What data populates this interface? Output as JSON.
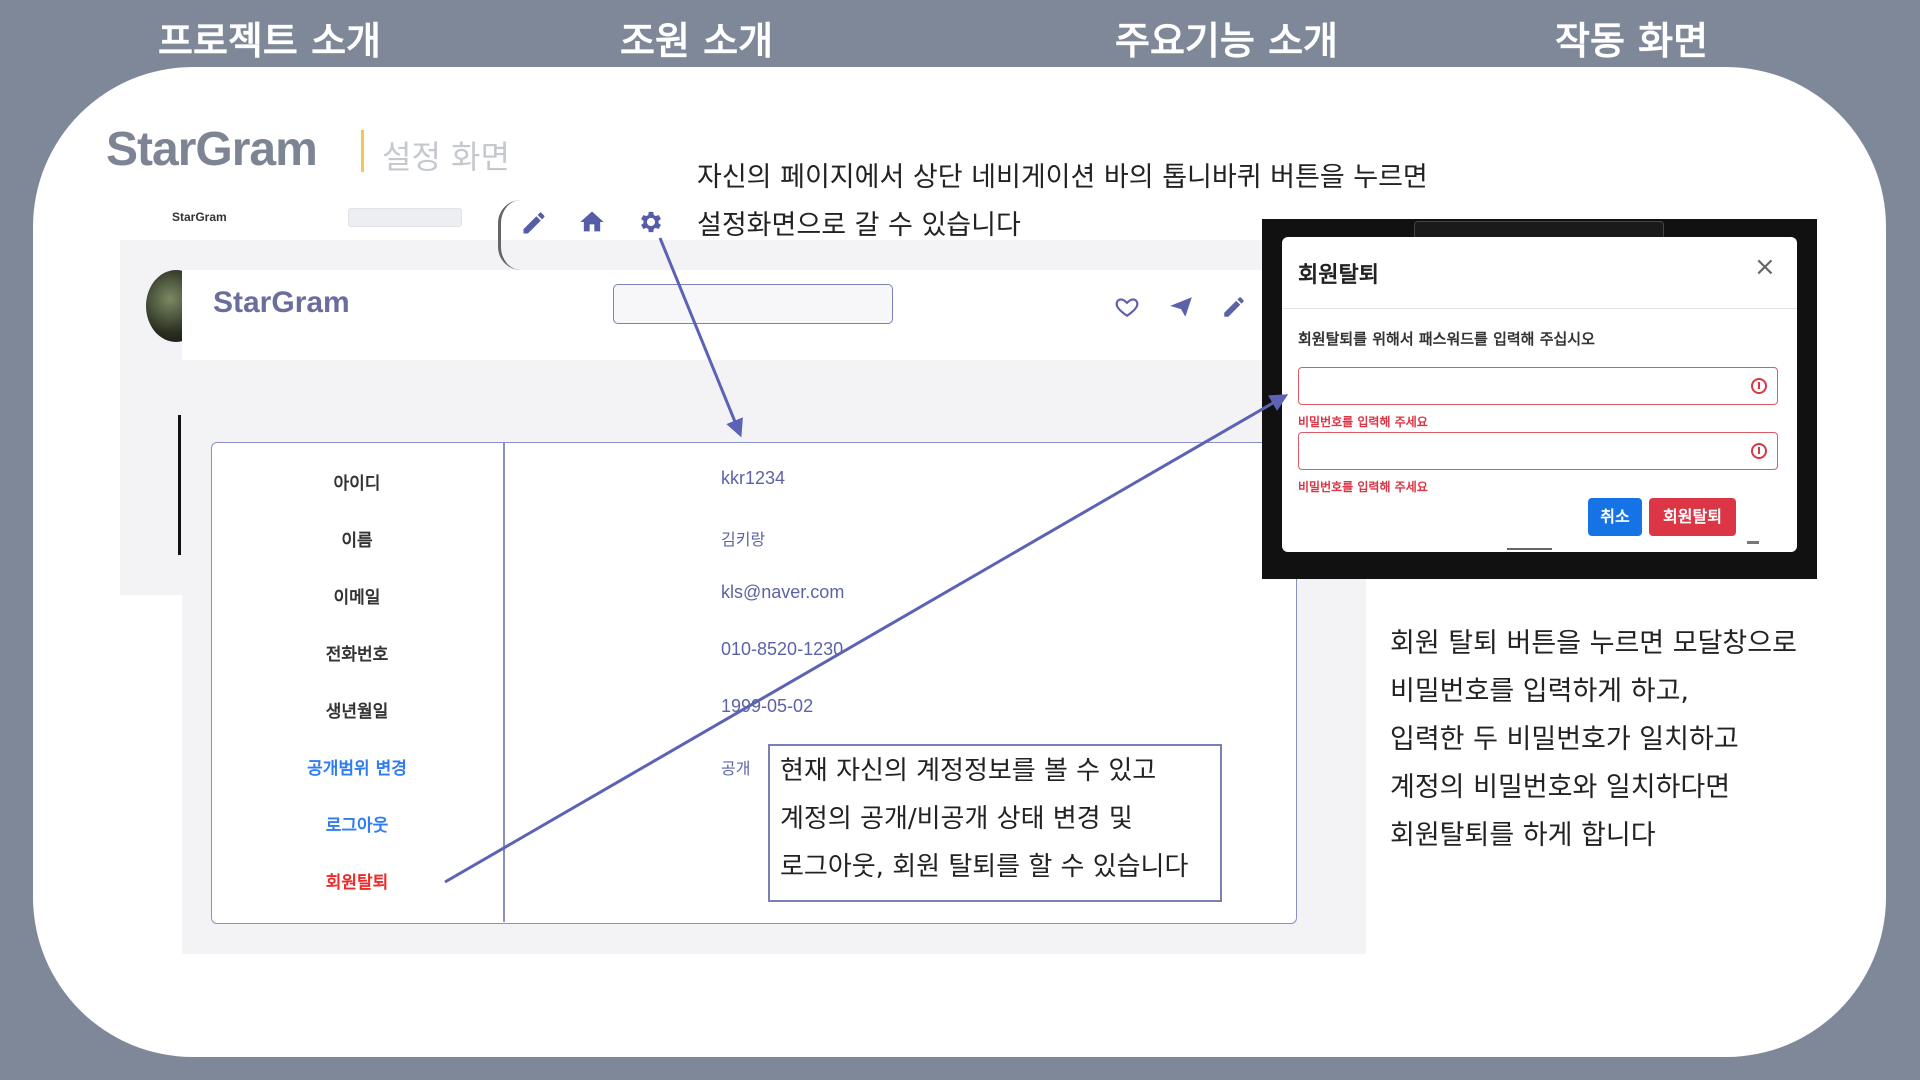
{
  "top_nav": [
    "프로젝트 소개",
    "조원 소개",
    "주요기능 소개",
    "작동 화면"
  ],
  "brand": {
    "logo": "StarGram",
    "subtitle": "설정 화면"
  },
  "captions": {
    "top": [
      "자신의 페이지에서 상단 네비게이션 바의 톱니바퀴 버튼을 누르면",
      "설정화면으로 갈 수 있습니다"
    ],
    "right": [
      "회원 탈퇴 버튼을 누르면 모달창으로",
      "비밀번호를 입력하게 하고,",
      "입력한 두 비밀번호가 일치하고",
      "계정의 비밀번호와 일치하다면",
      "회원탈퇴를 하게 합니다"
    ],
    "callout": [
      "현재 자신의 계정정보를 볼 수 있고",
      "계정의 공개/비공개 상태 변경 및",
      "로그아웃, 회원 탈퇴를 할 수 있습니다"
    ]
  },
  "app": {
    "small_brand": "StarGram",
    "brand": "StarGram",
    "nav_icons": [
      "pencil-icon",
      "home-icon",
      "gear-icon"
    ],
    "header_icons": [
      "heart-icon",
      "send-icon",
      "pencil-icon"
    ],
    "rows": [
      {
        "label": "아이디",
        "value": "kkr1234"
      },
      {
        "label": "이름",
        "value": "김키랑"
      },
      {
        "label": "이메일",
        "value": "kls@naver.com"
      },
      {
        "label": "전화번호",
        "value": "010-8520-1230"
      },
      {
        "label": "생년월일",
        "value": "1999-05-02"
      },
      {
        "label": "공개범위 변경",
        "value": "공개"
      },
      {
        "label": "로그아웃",
        "value": ""
      },
      {
        "label": "회원탈퇴",
        "value": ""
      }
    ]
  },
  "modal": {
    "title": "회원탈퇴",
    "close": "×",
    "description": "회원탈퇴를 위해서 패스워드를 입력해 주십시오",
    "error": "비밀번호를 입력해 주세요",
    "cancel_label": "취소",
    "confirm_label": "회원탈퇴"
  },
  "colors": {
    "background": "#7f8898",
    "accent": "#5c62b4",
    "danger": "#dc3545",
    "primary": "#1673e6",
    "link": "#2f7df0"
  }
}
